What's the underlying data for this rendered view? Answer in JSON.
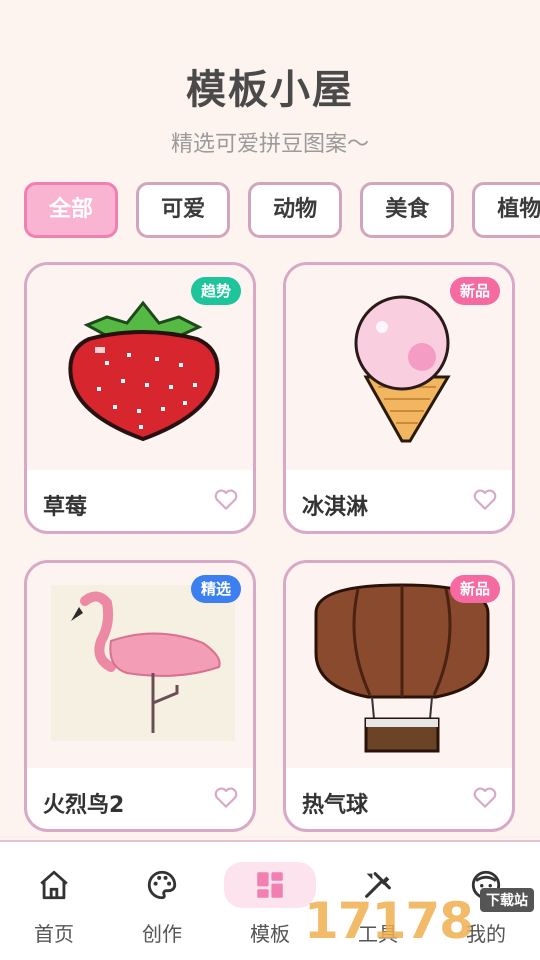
{
  "header": {
    "title": "模板小屋",
    "subtitle": "精选可爱拼豆图案～"
  },
  "categories": [
    {
      "label": "全部",
      "active": true
    },
    {
      "label": "可爱",
      "active": false
    },
    {
      "label": "动物",
      "active": false
    },
    {
      "label": "美食",
      "active": false
    },
    {
      "label": "植物",
      "active": false
    }
  ],
  "templates": [
    {
      "name": "草莓",
      "badge": "趋势",
      "badge_color": "#1ec59b"
    },
    {
      "name": "冰淇淋",
      "badge": "新品",
      "badge_color": "#f56aa1"
    },
    {
      "name": "火烈鸟2",
      "badge": "精选",
      "badge_color": "#3b7ff0"
    },
    {
      "name": "热气球",
      "badge": "新品",
      "badge_color": "#f56aa1"
    }
  ],
  "nav": [
    {
      "label": "首页",
      "icon": "home-icon"
    },
    {
      "label": "创作",
      "icon": "palette-icon"
    },
    {
      "label": "模板",
      "icon": "grid-icon",
      "active": true
    },
    {
      "label": "工具",
      "icon": "tools-icon"
    },
    {
      "label": "我的",
      "icon": "face-icon"
    }
  ],
  "watermark": {
    "digits": "17178",
    "tag": "下载站"
  },
  "colors": {
    "accent": "#f27fb1",
    "card_border": "#d7a9c6",
    "background": "#fdf3ef"
  }
}
